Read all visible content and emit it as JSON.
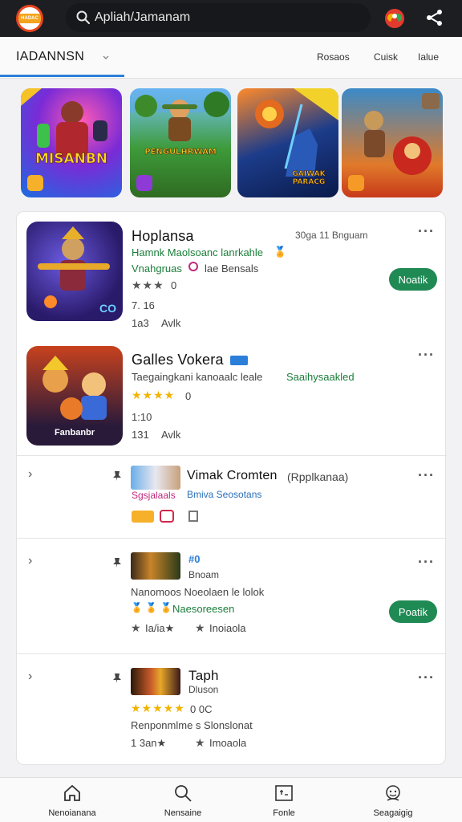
{
  "header": {
    "logo_text": "HADAC",
    "search_text": "Apliah/Jamanam",
    "play_icon": "play-games-icon",
    "share_icon": "share-icon"
  },
  "tabs": {
    "main_label": "IADANNSN",
    "links": [
      "Rosaos",
      "Cuisk",
      "Ialue"
    ]
  },
  "carousel": [
    {
      "title": "MISANBN",
      "badge": "amber"
    },
    {
      "title": "PENGULHRWAM",
      "badge": "purple"
    },
    {
      "title": "GAIWAK PARACG",
      "badge": "none"
    },
    {
      "title": "",
      "badge": "orange"
    }
  ],
  "apps": [
    {
      "title": "Hoplansa",
      "meta": "30ga 11 Bnguam",
      "line1": "Hamnk Maolsoanc lanrkahle",
      "line2": "Vnahgruas",
      "line2b": "lae Bensals",
      "stars_text": "★★★",
      "rating": "0",
      "size": "7. 16",
      "downloads": "1a3",
      "downloads_label": "Avlk",
      "button": "Noatik",
      "thumb_badge": "CO"
    },
    {
      "title": "Galles Vokera",
      "meta": "",
      "line1": "Taegaingkani kanoaalc leale",
      "line1b": "Saaihysaakled",
      "stars_text": "★★★★",
      "rating": "0",
      "size": "1:10",
      "downloads": "131",
      "downloads_label": "Avlk",
      "thumb_caption": "Fanbanbr"
    }
  ],
  "list_items": [
    {
      "chevron": "›",
      "title": "Vimak Cromten",
      "title_suffix": "(Rpplkanaa)",
      "sub_pink": "Sgsjalaals",
      "sub_blue": "Bmiva Seosotans"
    },
    {
      "chevron": "›",
      "tag": "#0",
      "sub": "Bnoam",
      "desc": "Nanomoos Noeolaen le lolok",
      "sub_green": "Naesoreesen",
      "stars_text": "★",
      "review_a": "Ia/ia★",
      "review_b": "Inoiaola",
      "button": "Poatik"
    },
    {
      "chevron": "›",
      "title": "Taph",
      "sub": "Dluson",
      "stars_text": "★★★★★",
      "rating": "0 0C",
      "desc": "Renponmlme s Slonslonat",
      "review_a": "1 3an★",
      "review_b": "Imoaola"
    }
  ],
  "bottom_nav": [
    {
      "label": "Nenoianana",
      "icon": "home-icon"
    },
    {
      "label": "Nensaine",
      "icon": "search-icon"
    },
    {
      "label": "Fonle",
      "icon": "calendar-icon"
    },
    {
      "label": "Seagaigig",
      "icon": "profile-icon"
    }
  ],
  "colors": {
    "topbar": "#1d1e22",
    "accent_blue": "#2c7fd8",
    "install_green": "#1f8a54",
    "star_gold": "#f2b400",
    "star_grey": "#555555"
  }
}
